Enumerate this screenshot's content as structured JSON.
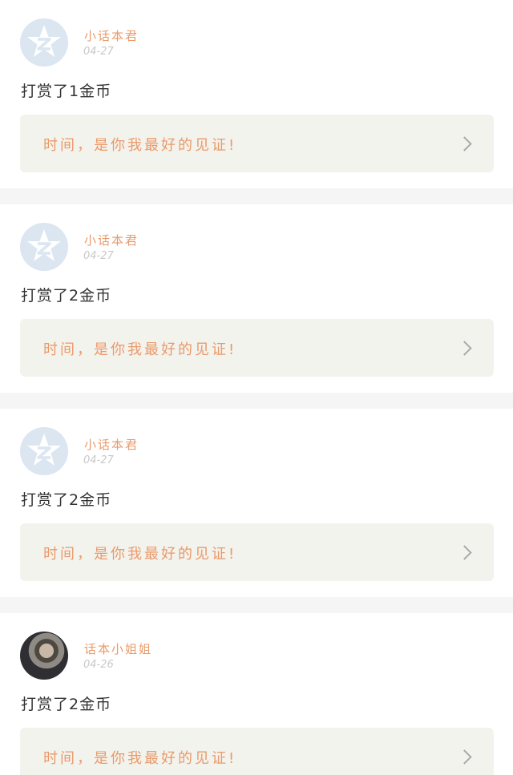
{
  "posts": [
    {
      "username": "小话本君",
      "date": "04-27",
      "action": "打赏了1金币",
      "quote": "时间，是你我最好的见证!",
      "avatar_icon": "qq-star-avatar-icon"
    },
    {
      "username": "小话本君",
      "date": "04-27",
      "action": "打赏了2金币",
      "quote": "时间，是你我最好的见证!",
      "avatar_icon": "qq-star-avatar-icon"
    },
    {
      "username": "小话本君",
      "date": "04-27",
      "action": "打赏了2金币",
      "quote": "时间，是你我最好的见证!",
      "avatar_icon": "qq-star-avatar-icon"
    },
    {
      "username": "话本小姐姐",
      "date": "04-26",
      "action": "打赏了2金币",
      "quote": "时间，是你我最好的见证!",
      "avatar_icon": "user-photo-avatar"
    }
  ],
  "colors": {
    "accent": "#ea9a6a",
    "quote_bg": "#f3f3ee",
    "avatar_bg": "#dbe6f1",
    "separator": "#f5f5f5"
  }
}
